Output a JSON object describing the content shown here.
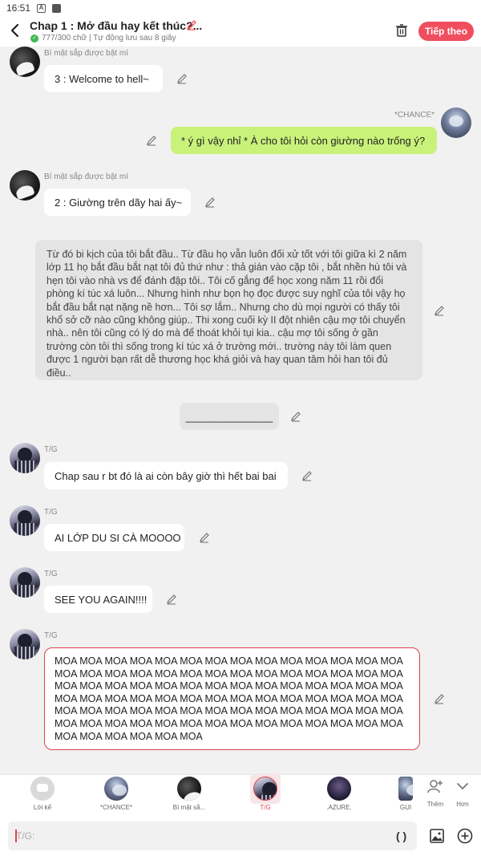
{
  "status": {
    "time": "16:51"
  },
  "header": {
    "title": "Chap 1 : Mở đầu hay kết thúc?...",
    "meta": "777/300 chữ | Tự động lưu sau 8 giây",
    "next_label": "Tiếp theo"
  },
  "messages": {
    "m1": {
      "name": "Bí mật sắp được bật mí",
      "text": "3 : Welcome to hell~"
    },
    "m2": {
      "name": "*CHANCE*",
      "text": "* ý gì vậy nhỉ * À cho tôi hỏi còn giường nào trống ý?"
    },
    "m3": {
      "name": "Bí mật sắp được bật mí",
      "text": "2 : Giường trên dãy hai ấy~"
    },
    "narration": "Từ đó bi kịch của tôi bắt đầu.. Từ đầu họ vẫn luôn đối xử tốt với tôi giữa kì 2 năm lớp 11 họ bắt đầu bắt nạt tôi đủ thứ như : thả gián vào cặp tôi , bắt nhền hù tôi và hẹn tôi vào nhà vs để đánh đập tôi.. Tôi cố gắng để học xong năm 11 rồi đổi phòng kí túc xá luôn... Nhưng hình như bọn họ đọc được suy nghĩ của tôi vậy họ bắt đầu bắt nạt nặng nề hơn... Tôi sợ lắm.. Nhưng cho dù mọi người có thấy tôi khổ sở cỡ nào cũng không giúp.. Thi xong cuối kỳ II đột nhiên cậu mợ tôi chuyển nhà.. nên tôi cũng có lý do mà để thoát khỏi tụi kia.. cậu mợ tôi sống ở gần trường còn tôi thì sống trong kí túc xá ở trường mới.. trường này tôi làm quen được 1 người bạn rất dễ thương học khá giỏi và hay quan tâm hỏi han tôi đủ điều..",
    "divider": "_______________",
    "m4": {
      "name": "T/G",
      "text": "Chap sau r bt đó là ai còn bây giờ thì hết bai bai"
    },
    "m5": {
      "name": "T/G",
      "text": "AI LỚP DU SI CÀ MOOOO"
    },
    "m6": {
      "name": "T/G",
      "text": "SEE YOU AGAIN!!!!"
    },
    "m7": {
      "name": "T/G",
      "text": "MOA MOA MOA MOA MOA MOA MOA MOA MOA MOA MOA MOA MOA MOA MOA MOA MOA MOA MOA MOA MOA MOA MOA MOA MOA MOA MOA MOA MOA MOA MOA MOA MOA MOA MOA MOA MOA MOA MOA MOA MOA MOA MOA MOA MOA MOA MOA MOA MOA MOA MOA MOA MOA MOA MOA MOA MOA MOA MOA MOA MOA MOA MOA MOA MOA MOA MOA MOA MOA MOA MOA MOA MOA MOA MOA MOA MOA MOA MOA MOA MOA MOA MOA MOA MOA MOA MOA MOA MOA MOA"
    }
  },
  "characters": {
    "narrator": "Lời kể",
    "chance": "*CHANCE*",
    "secret": "Bí mật sắ...",
    "tg": "T/G",
    "azure": ".AZURE.",
    "gui": "GUI",
    "add": "Thêm",
    "more": "Hơn"
  },
  "composer": {
    "placeholder": "T/G:",
    "paren": "( )"
  },
  "colors": {
    "accent": "#f04e5e",
    "green_bubble": "#c9f27a"
  }
}
